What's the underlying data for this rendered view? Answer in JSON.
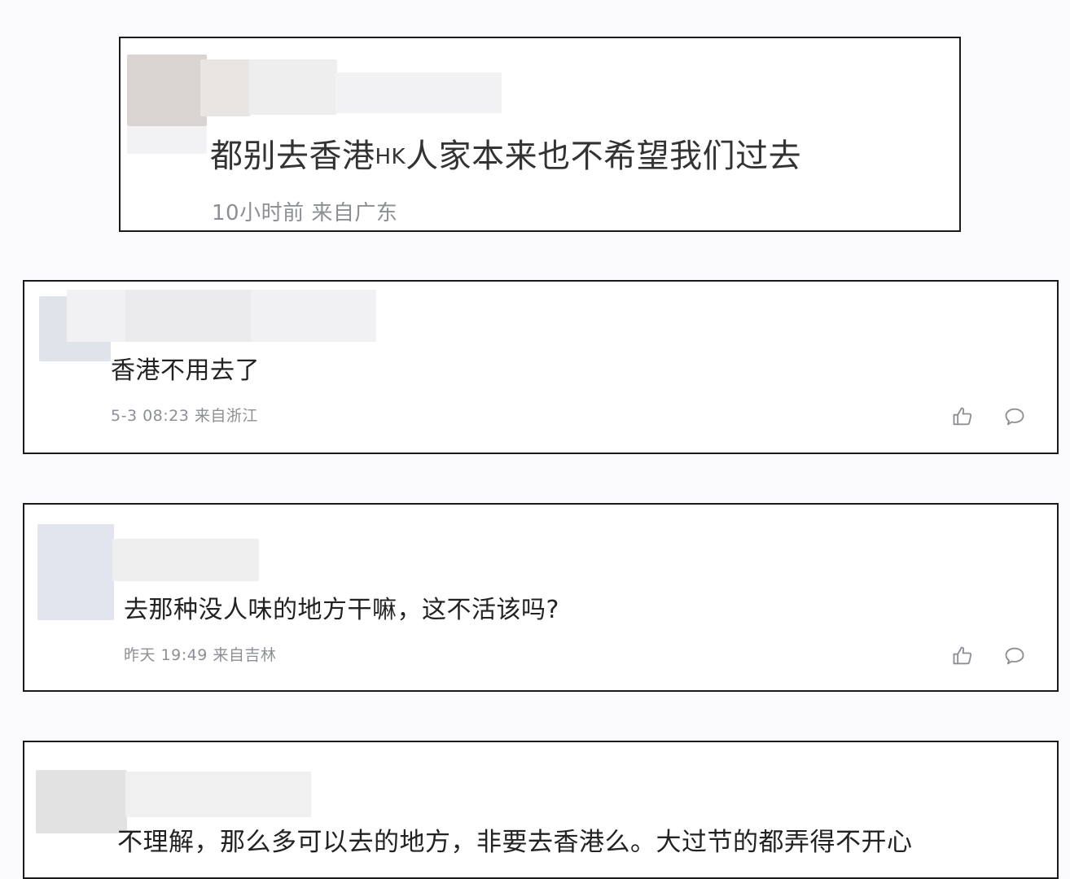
{
  "comments": [
    {
      "text": "都别去香港",
      "text_inline": "HK",
      "text_rest": "人家本来也不希望我们过去",
      "meta": "10小时前 来自广东",
      "show_actions": false
    },
    {
      "text": "香港不用去了",
      "meta": "5-3 08:23 来自浙江",
      "show_actions": true
    },
    {
      "text": "去那种没人味的地方干嘛，这不活该吗?",
      "meta": "昨天 19:49 来自吉林",
      "show_actions": true
    },
    {
      "text": "不理解，那么多可以去的地方，非要去香港么。大过节的都弄得不开心",
      "meta": "",
      "show_actions": false
    }
  ],
  "icons": {
    "like": "thumbs-up-icon",
    "reply": "comment-bubble-icon"
  },
  "colors": {
    "border": "#1a1a1a",
    "meta_text": "#8d8f96",
    "body_text": "#222222",
    "blur_gray": "#d6d1ce",
    "blur_blue": "#dfe3ec"
  }
}
